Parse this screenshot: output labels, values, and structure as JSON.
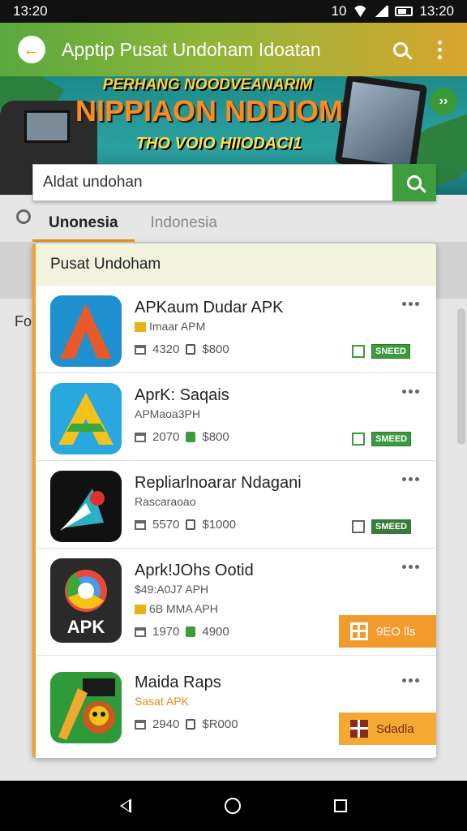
{
  "status_bar": {
    "time_left": "13:20",
    "time_right": "13:20",
    "left_icons": "10"
  },
  "app_bar": {
    "title": "Apptip Pusat Undoham Idoatan",
    "back_icon": "back-arrow-icon"
  },
  "banner": {
    "line1": "PERHANG NOODVEANARIM",
    "line2": "NIPPIAON NDDIOM",
    "line3": "THO VOIO HIIODACI1"
  },
  "search": {
    "placeholder": "Aldat undohan",
    "value": "Aldat undohan"
  },
  "tabs": [
    {
      "label": "Unonesia",
      "active": true
    },
    {
      "label": "Indonesia",
      "active": false
    }
  ],
  "background_side_text": "For",
  "card": {
    "title": "Pusat Undoham",
    "apps": [
      {
        "name": "APKaum Dudar APK",
        "sub": "Imaar APM",
        "downloads": "4320",
        "price": "$800",
        "status": "SNEED",
        "colors": [
          "#1e90d0",
          "#e85a2a"
        ]
      },
      {
        "name": "AprK: Saqais",
        "sub": "APMaoa3PH",
        "downloads": "2070",
        "price": "$800",
        "status": "SMEED",
        "colors": [
          "#29a8e0",
          "#f4c21a"
        ]
      },
      {
        "name": "Repliarlnoarar Ndagani",
        "sub": "Rascaraoao",
        "downloads": "5570",
        "price": "$1000",
        "status": "SMEED",
        "colors": [
          "#111111",
          "#e03030"
        ]
      },
      {
        "name": "Aprk!JOhs Ootid",
        "sub": "$49:A0J7 APH",
        "sub2": "6B MMA APH",
        "downloads": "1970",
        "price": "4900",
        "action": "9EO lls",
        "icon_text": "APK",
        "colors": [
          "#2a2a2a",
          "#4a9ae8"
        ]
      },
      {
        "name": "Maida Raps",
        "sub": "Sasat APK",
        "downloads": "2940",
        "price": "$R000",
        "action": "Sdadla",
        "colors": [
          "#2e9a3a",
          "#f0a830"
        ]
      }
    ]
  }
}
